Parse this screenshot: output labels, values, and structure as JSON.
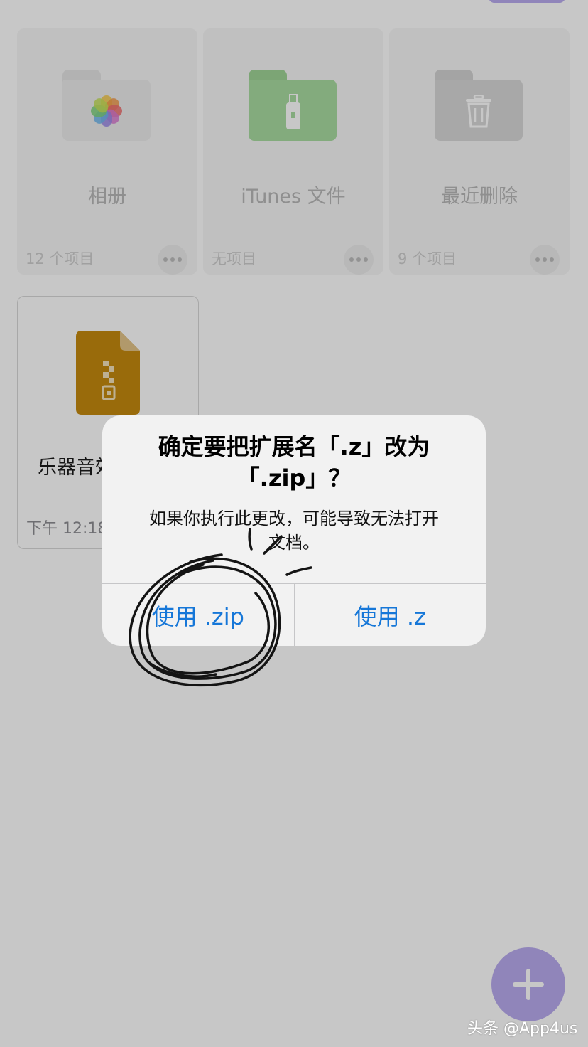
{
  "colors": {
    "accent": "#b9abef",
    "link_blue": "#1677d8",
    "zip_file": "#c58a0f",
    "itunes_folder": "#a8dca0",
    "photos_folder": "#ececec",
    "trash_folder": "#d8d8d8"
  },
  "folders": [
    {
      "name": "相册",
      "count": "12 个项目",
      "icon": "photos-icon"
    },
    {
      "name": "iTunes 文件",
      "count": "无项目",
      "icon": "usb-icon"
    },
    {
      "name": "最近删除",
      "count": "9 个项目",
      "icon": "trash-icon"
    }
  ],
  "file": {
    "name": "乐器音效",
    "time": "下午 12:18",
    "icon": "zip-file-icon"
  },
  "alert": {
    "title": "确定要把扩展名「.z」改为「.zip」？",
    "message": "如果你执行此更改，可能导致无法打开文档。",
    "primary_button": "使用 .zip",
    "secondary_button": "使用 .z"
  },
  "fab": {
    "icon": "plus-icon"
  },
  "watermark": "头条 @App4us"
}
